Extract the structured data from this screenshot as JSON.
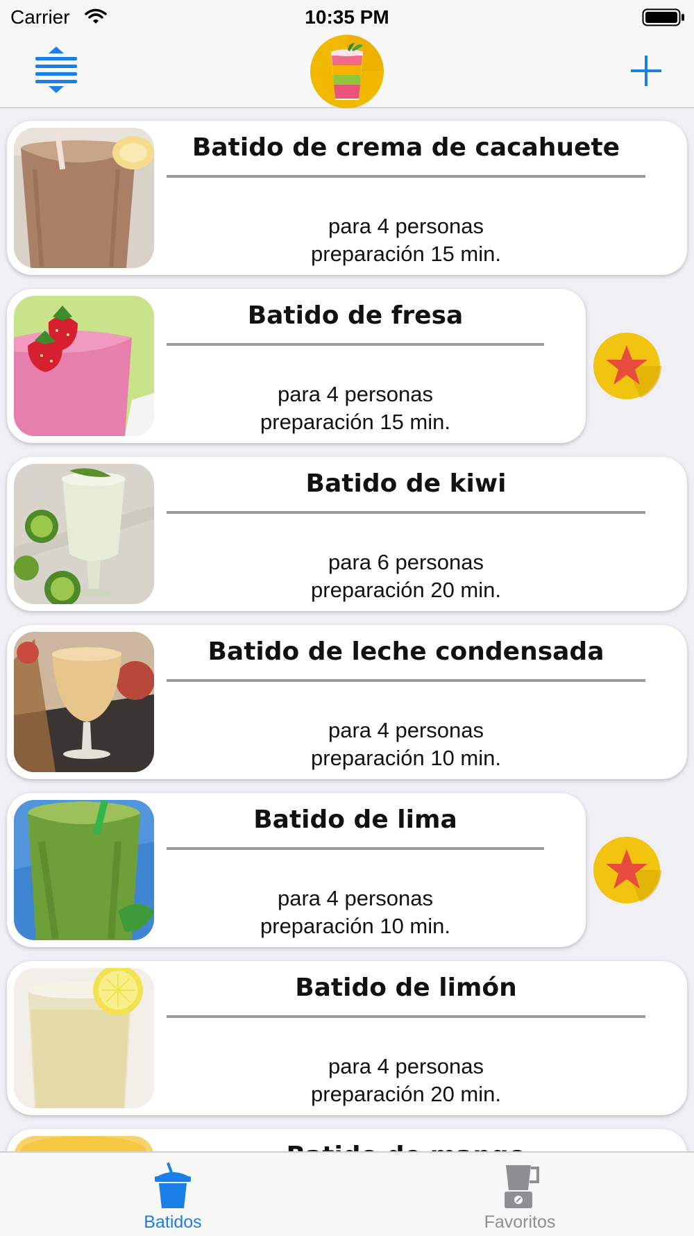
{
  "status_bar": {
    "carrier": "Carrier",
    "time": "10:35 PM"
  },
  "nav": {
    "left_icon": "reorder-icon",
    "logo_icon": "smoothie-logo",
    "right_icon": "plus-icon"
  },
  "smoothies": [
    {
      "title": "Batido de crema de cacahuete",
      "servings": "para 4 personas",
      "prep": "preparación 15 min.",
      "favorite": false,
      "image": "peanut-butter-smoothie"
    },
    {
      "title": "Batido de fresa",
      "servings": "para 4 personas",
      "prep": "preparación 15 min.",
      "favorite": true,
      "image": "strawberry-smoothie"
    },
    {
      "title": "Batido de kiwi",
      "servings": "para 6 personas",
      "prep": "preparación 20 min.",
      "favorite": false,
      "image": "kiwi-smoothie"
    },
    {
      "title": "Batido de leche condensada",
      "servings": "para 4 personas",
      "prep": "preparación 10 min.",
      "favorite": false,
      "image": "condensed-milk-smoothie"
    },
    {
      "title": "Batido de lima",
      "servings": "para 4 personas",
      "prep": "preparación 10 min.",
      "favorite": true,
      "image": "lime-smoothie"
    },
    {
      "title": "Batido de limón",
      "servings": "para 4 personas",
      "prep": "preparación 20 min.",
      "favorite": false,
      "image": "lemon-smoothie"
    },
    {
      "title": "Batido de mango",
      "servings": "",
      "prep": "",
      "favorite": false,
      "image": "mango-smoothie"
    }
  ],
  "tabs": [
    {
      "label": "Batidos",
      "icon": "cup-icon",
      "active": true
    },
    {
      "label": "Favoritos",
      "icon": "blender-icon",
      "active": false
    }
  ],
  "colors": {
    "accent": "#1a7fe6",
    "favorite_badge": "#f1c40f",
    "favorite_star": "#e74c3c",
    "tab_inactive": "#8e8e93"
  }
}
